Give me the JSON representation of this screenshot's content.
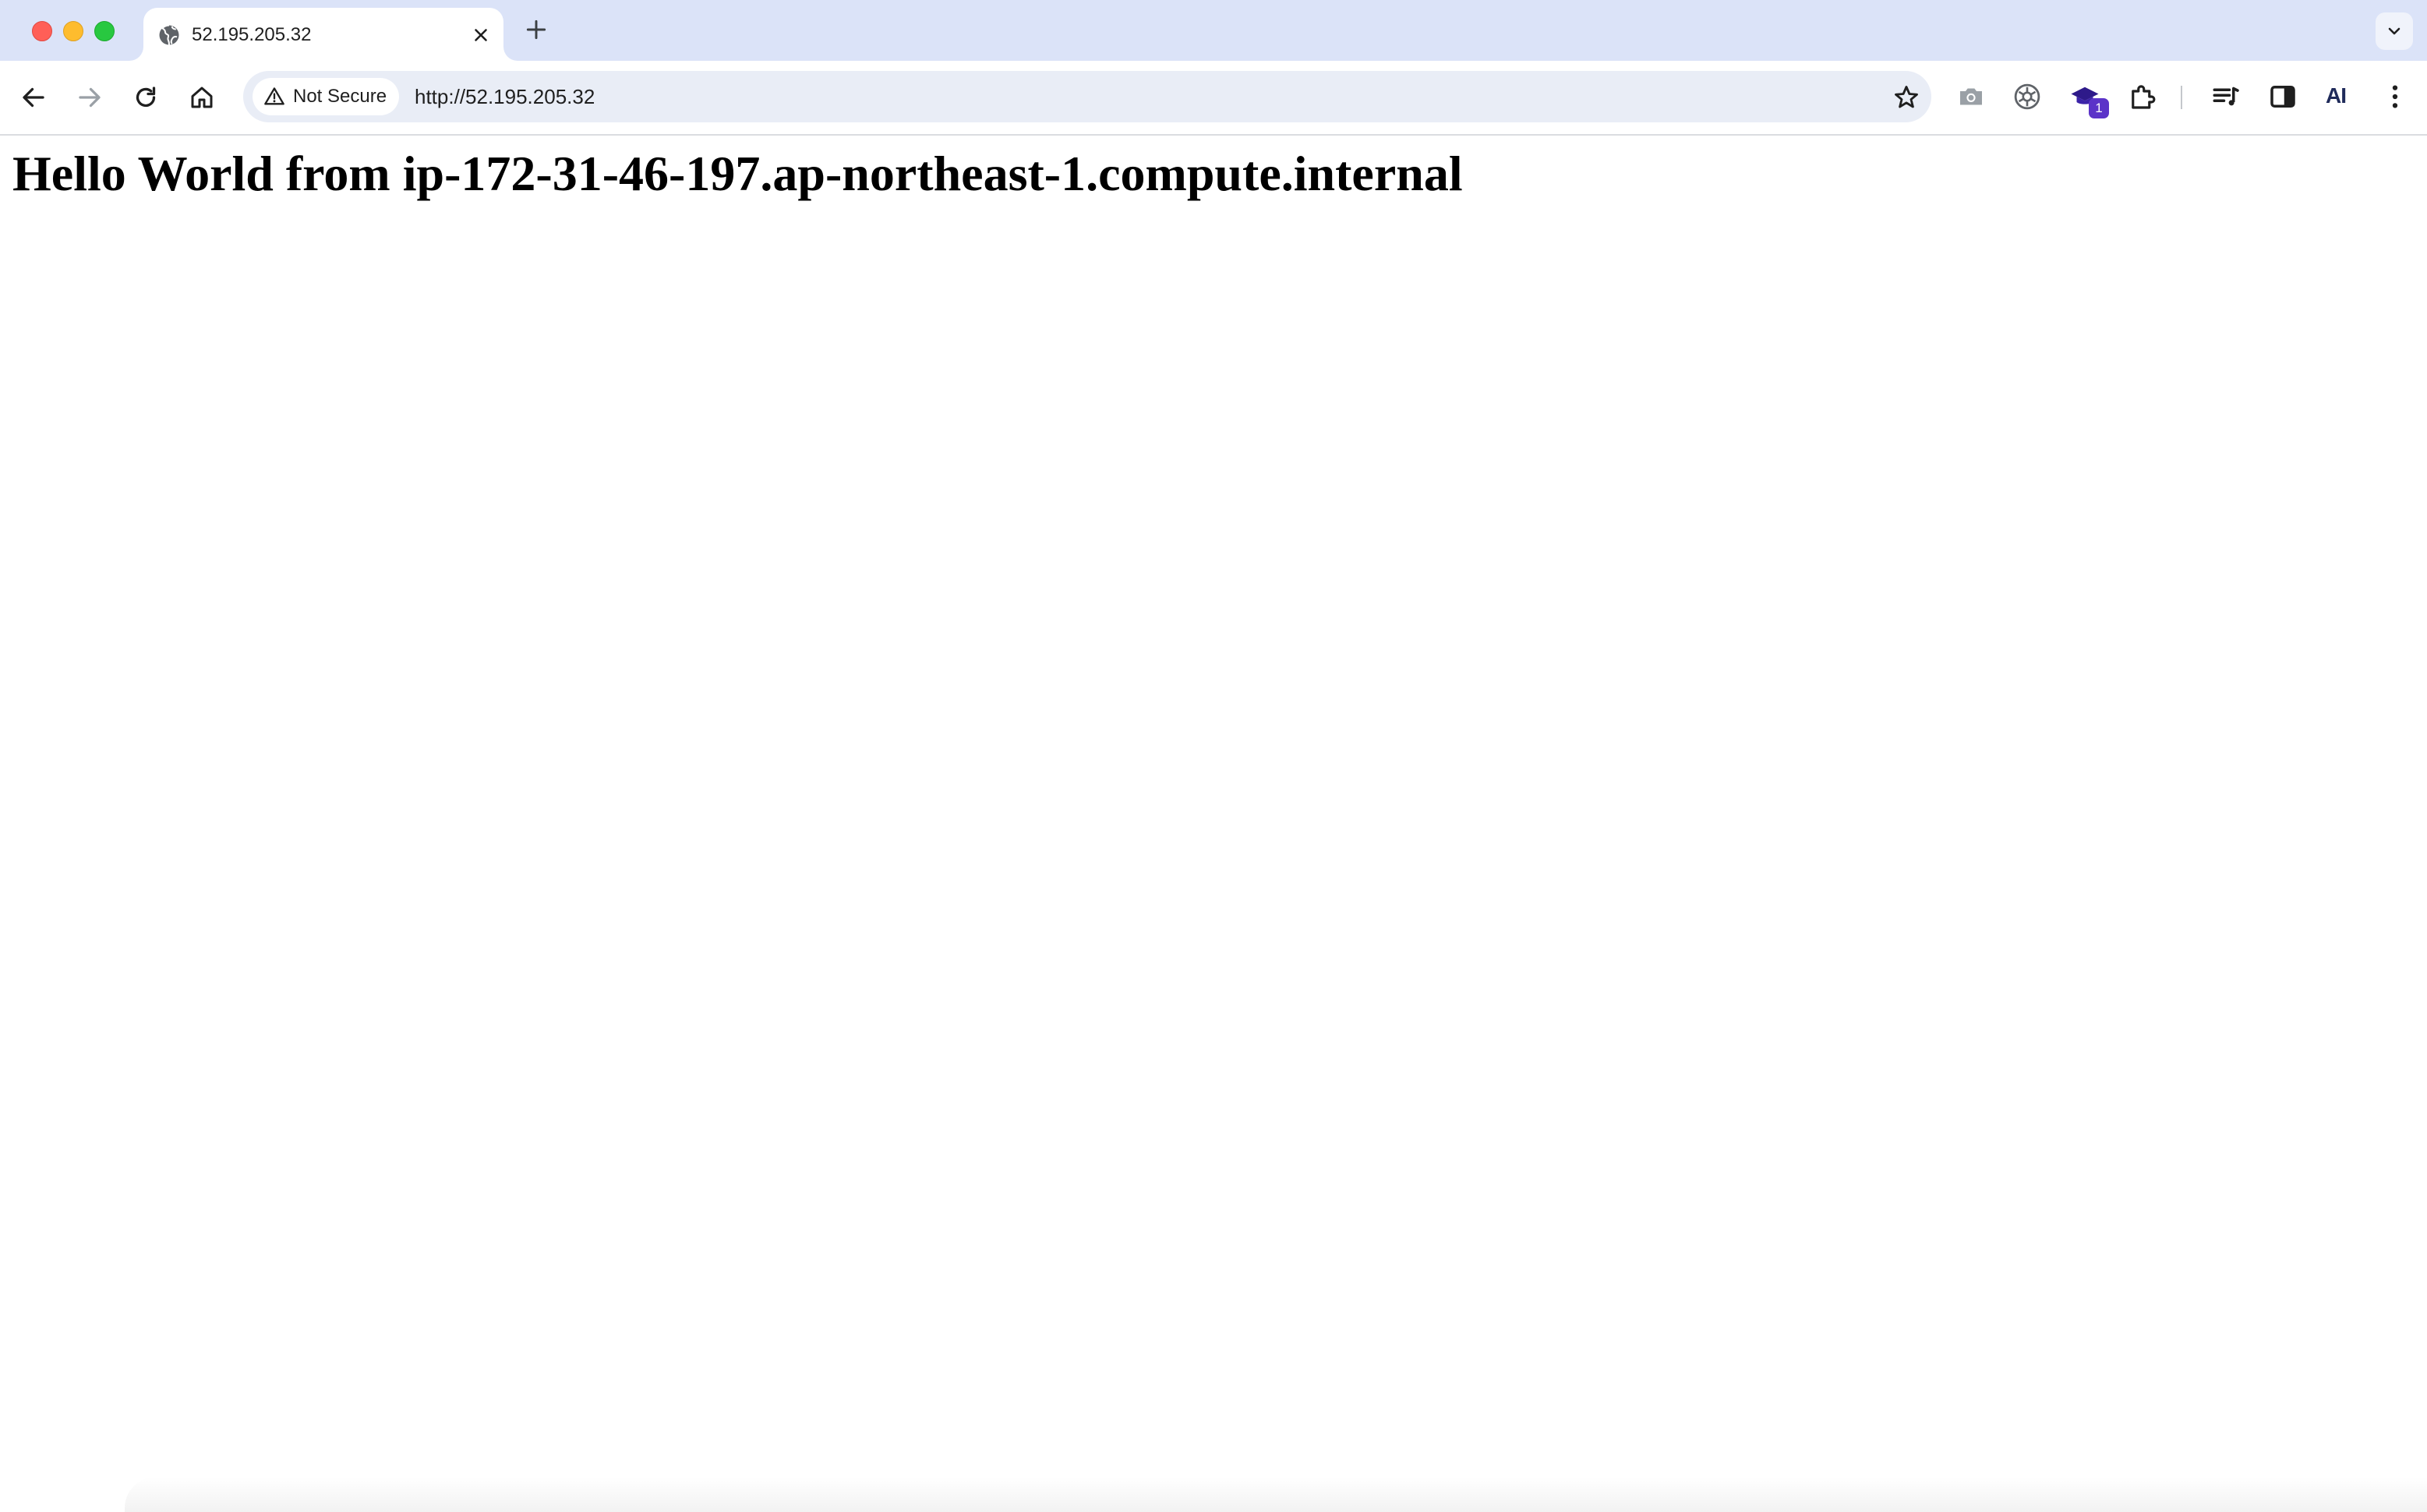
{
  "browser": {
    "tab": {
      "title": "52.195.205.32"
    },
    "omnibox": {
      "security_label": "Not Secure",
      "url": "http://52.195.205.32"
    },
    "extensions": {
      "badge_count": "1",
      "ai_label": "AI"
    }
  },
  "page": {
    "heading": "Hello World from ip-172-31-46-197.ap-northeast-1.compute.internal"
  }
}
